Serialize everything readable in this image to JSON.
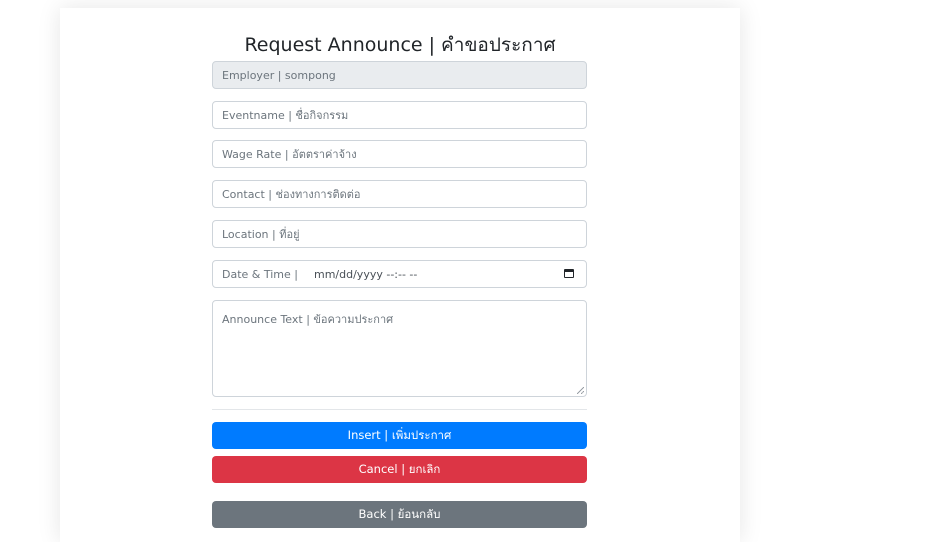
{
  "page": {
    "title": "Request Announce | คำขอประกาศ"
  },
  "form": {
    "employer": {
      "value": "Employer | sompong"
    },
    "eventname": {
      "placeholder": "Eventname | ชื่อกิจกรรม"
    },
    "wage_rate": {
      "placeholder": "Wage Rate | อัตตราค่าจ้าง"
    },
    "contact": {
      "placeholder": "Contact | ช่องทางการติดต่อ"
    },
    "location": {
      "placeholder": "Location | ที่อยู่"
    },
    "datetime": {
      "label": "Date & Time |",
      "placeholder": "mm/dd/yyyy --:-- --",
      "icon": "calendar-icon"
    },
    "announce_text": {
      "placeholder": "Announce Text | ข้อความประกาศ"
    }
  },
  "buttons": {
    "insert": "Insert | เพิ่มประกาศ",
    "cancel": "Cancel | ยกเลิก",
    "back": "Back | ย้อนกลับ"
  },
  "colors": {
    "primary": "#007bff",
    "danger": "#dc3545",
    "secondary": "#6c757d"
  }
}
